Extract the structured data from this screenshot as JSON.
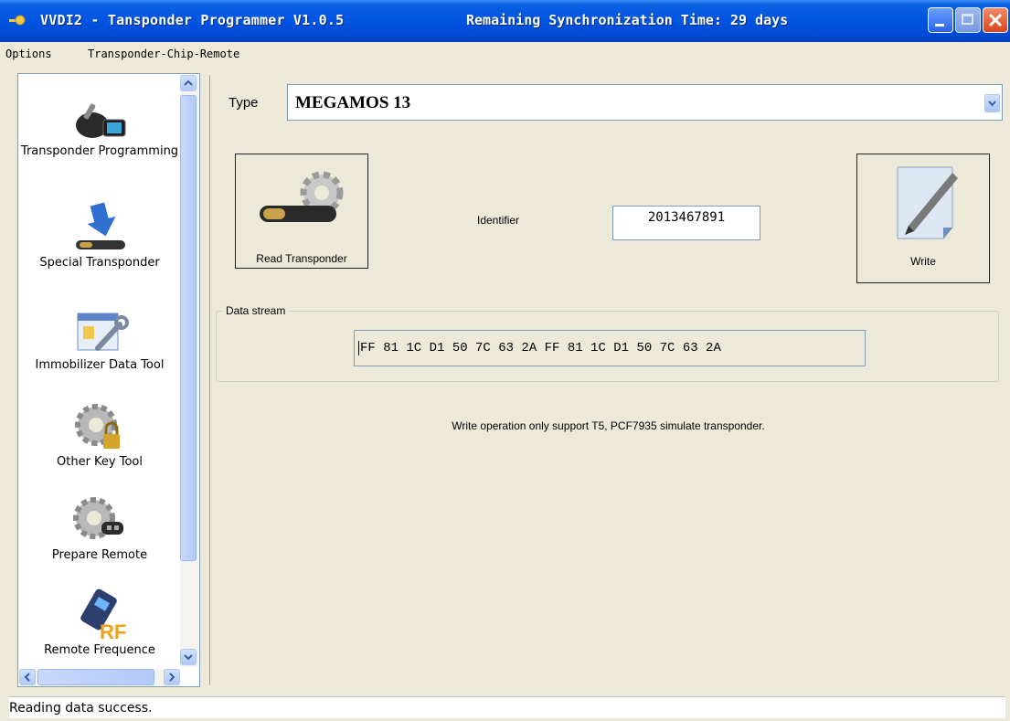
{
  "window": {
    "title": "VVDI2 - Tansponder Programmer V1.0.5",
    "sync_info": "Remaining Synchronization Time: 29 days",
    "colors": {
      "titlebar": "#0054e3",
      "close": "#d9461a",
      "face": "#ece9d8"
    }
  },
  "menubar": {
    "items": [
      {
        "label": "Options"
      },
      {
        "label": "Transponder-Chip-Remote"
      }
    ]
  },
  "sidebar": {
    "items": [
      {
        "label": "Transponder Programming",
        "icon": "key-programmer-icon"
      },
      {
        "label": "Special Transponder",
        "icon": "download-arrow-icon"
      },
      {
        "label": "Immobilizer Data Tool",
        "icon": "wrench-tool-icon"
      },
      {
        "label": "Other Key Tool",
        "icon": "gear-lock-icon"
      },
      {
        "label": "Prepare Remote",
        "icon": "gear-remote-icon"
      },
      {
        "label": "Remote Frequence",
        "icon": "rf-remote-icon"
      }
    ]
  },
  "main": {
    "type_label": "Type",
    "type_value": "MEGAMOS 13",
    "read_button": "Read Transponder",
    "write_button": "Write",
    "identifier_label": "Identifier",
    "identifier_value": "2013467891",
    "data_stream_label": "Data stream",
    "data_stream_value": "FF 81 1C D1 50 7C 63 2A FF 81 1C D1 50 7C 63 2A",
    "note": "Write operation only support T5, PCF7935 simulate transponder."
  },
  "status": {
    "text": "Reading data success."
  }
}
